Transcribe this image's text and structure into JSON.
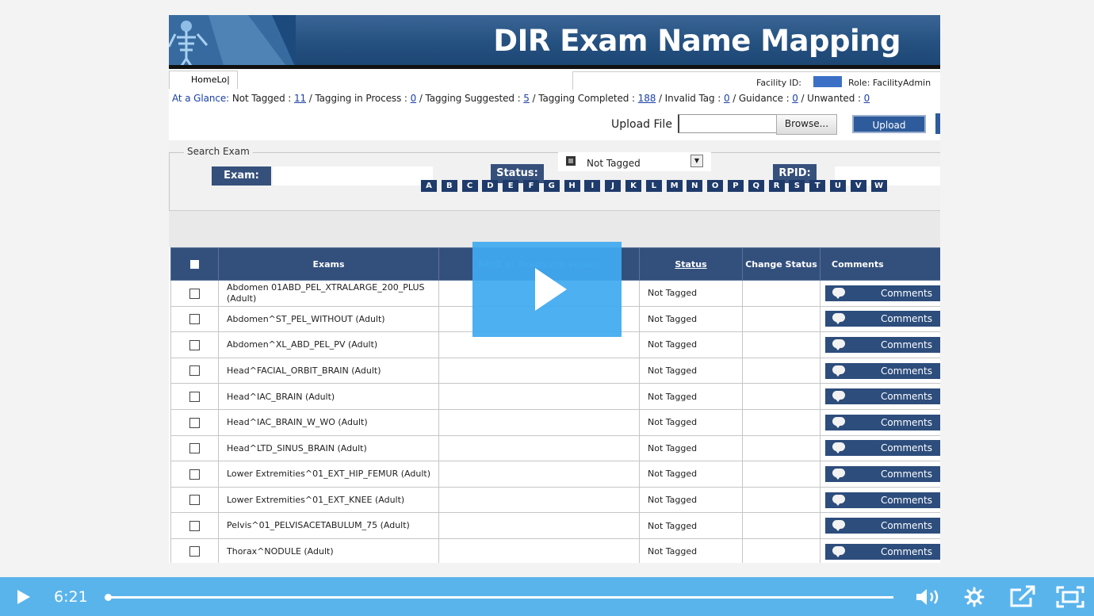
{
  "page": {
    "title": "DIR Exam Name Mapping",
    "home_tab": "HomeLo|",
    "facility_label": "Facility ID:",
    "role_label": "Role: FacilityAdmin"
  },
  "glance": {
    "label": "At a Glance:",
    "items": [
      {
        "label": "Not Tagged :",
        "count": "11"
      },
      {
        "label": "Tagging in Process :",
        "count": "0"
      },
      {
        "label": "Tagging Suggested :",
        "count": "5"
      },
      {
        "label": "Tagging Completed :",
        "count": "188"
      },
      {
        "label": "Invalid Tag :",
        "count": "0"
      },
      {
        "label": "Guidance :",
        "count": "0"
      },
      {
        "label": "Unwanted :",
        "count": "0"
      }
    ]
  },
  "upload": {
    "label": "Upload File",
    "browse": "Browse...",
    "button": "Upload"
  },
  "search": {
    "legend": "Search Exam",
    "exam_label": "Exam:",
    "status_label": "Status:",
    "status_value": "Not Tagged",
    "rpid_label": "RPID:",
    "letters": [
      "A",
      "B",
      "C",
      "D",
      "E",
      "F",
      "G",
      "H",
      "I",
      "J",
      "K",
      "L",
      "M",
      "N",
      "O",
      "P",
      "Q",
      "R",
      "S",
      "T",
      "U",
      "V",
      "W"
    ]
  },
  "table": {
    "headers": {
      "exams": "Exams",
      "rpid": "RPID or Predicate values",
      "status": "Status",
      "change_status": "Change Status",
      "comments": "Comments"
    },
    "comment_label": "Comments",
    "rows": [
      {
        "exam": "Abdomen 01ABD_PEL_XTRALARGE_200_PLUS (Adult)",
        "status": "Not Tagged"
      },
      {
        "exam": "Abdomen^ST_PEL_WITHOUT (Adult)",
        "status": "Not Tagged"
      },
      {
        "exam": "Abdomen^XL_ABD_PEL_PV (Adult)",
        "status": "Not Tagged"
      },
      {
        "exam": "Head^FACIAL_ORBIT_BRAIN (Adult)",
        "status": "Not Tagged"
      },
      {
        "exam": "Head^IAC_BRAIN (Adult)",
        "status": "Not Tagged"
      },
      {
        "exam": "Head^IAC_BRAIN_W_WO (Adult)",
        "status": "Not Tagged"
      },
      {
        "exam": "Head^LTD_SINUS_BRAIN (Adult)",
        "status": "Not Tagged"
      },
      {
        "exam": "Lower Extremities^01_EXT_HIP_FEMUR (Adult)",
        "status": "Not Tagged"
      },
      {
        "exam": "Lower Extremities^01_EXT_KNEE (Adult)",
        "status": "Not Tagged"
      },
      {
        "exam": "Pelvis^01_PELVISACETABULUM_75 (Adult)",
        "status": "Not Tagged"
      },
      {
        "exam": "Thorax^NODULE (Adult)",
        "status": "Not Tagged"
      }
    ]
  },
  "player": {
    "time": "6:21",
    "progress": 0.004,
    "accent": "#5ab4ec"
  }
}
